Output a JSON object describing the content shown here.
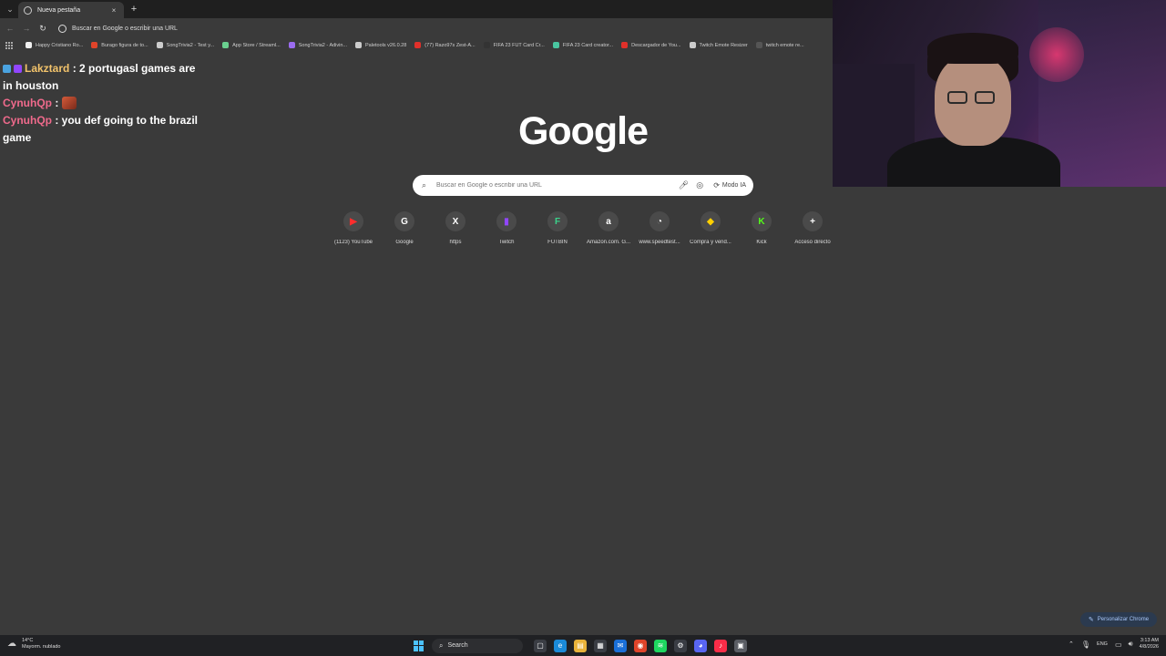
{
  "tab": {
    "title": "Nueva pestaña",
    "close": "×",
    "new": "+"
  },
  "toolbar": {
    "back": "←",
    "forward": "→",
    "reload": "↻",
    "omnibox_text": "Buscar en Google o escribir una URL"
  },
  "bookmarks": [
    {
      "label": "Happy Cristiano Ro...",
      "color": "#f0f0f0"
    },
    {
      "label": "Burago figura de to...",
      "color": "#e0442a"
    },
    {
      "label": "SongTrivia2 - Test y...",
      "color": "#cccccc"
    },
    {
      "label": "App Store / Streaml...",
      "color": "#6ad08f"
    },
    {
      "label": "SongTrivia2 - Adivin...",
      "color": "#9b6cf0"
    },
    {
      "label": "Paletools v26.0.28",
      "color": "#cccccc"
    },
    {
      "label": "(77) Razo97s Zest-A...",
      "color": "#e0302a"
    },
    {
      "label": "FIFA 23 FUT Card Cr...",
      "color": "#333333"
    },
    {
      "label": "FIFA 23 Card creator...",
      "color": "#49c5a0"
    },
    {
      "label": "Descargador de You...",
      "color": "#e0302a"
    },
    {
      "label": "Twitch Emote Resizer",
      "color": "#cccccc"
    },
    {
      "label": "twitch emote re...",
      "color": "#555555"
    }
  ],
  "chat": {
    "line1_user": "Lakztard",
    "line1_msg": ": 2 portugasl games are in houston",
    "line2_user": "CynuhQp",
    "line2_sep": ":",
    "line3_user": "CynuhQp",
    "line3_msg": ": you def going to the brazil game"
  },
  "google": {
    "logo": "Google",
    "search_placeholder": "Buscar en Google o escribir una URL",
    "ai_mode": "Modo IA"
  },
  "shortcuts": [
    {
      "label": "(1123) YouTube",
      "icon": "▶",
      "color": "#ff2d2d",
      "icon_name": "youtube-icon"
    },
    {
      "label": "Google",
      "icon": "G",
      "color": "#ffffff",
      "icon_name": "google-icon"
    },
    {
      "label": "https",
      "icon": "X",
      "color": "#ffffff",
      "icon_name": "x-icon"
    },
    {
      "label": "Twitch",
      "icon": "▮",
      "color": "#9146ff",
      "icon_name": "twitch-icon"
    },
    {
      "label": "FUTBIN",
      "icon": "F",
      "color": "#3bd38b",
      "icon_name": "futbin-icon"
    },
    {
      "label": "Amazon.com. G...",
      "icon": "a",
      "color": "#ffffff",
      "icon_name": "amazon-icon"
    },
    {
      "label": "www.speedtest...",
      "icon": "◔",
      "color": "#ffffff",
      "icon_name": "speedtest-icon"
    },
    {
      "label": "Compra y vend...",
      "icon": "◆",
      "color": "#ffd000",
      "icon_name": "store-icon"
    },
    {
      "label": "Kick",
      "icon": "K",
      "color": "#53fc18",
      "icon_name": "kick-icon"
    },
    {
      "label": "Acceso directo",
      "icon": "+",
      "color": "#ffffff",
      "icon_name": "add-shortcut-icon"
    }
  ],
  "personalize": "Personalizar Chrome",
  "taskbar": {
    "weather_temp": "14°C",
    "weather_desc": "Mayorm. nublado",
    "search": "Search",
    "lang": "ENG",
    "time": "3:13 AM",
    "date": "4/8/2026",
    "apps": [
      {
        "name": "file-icon",
        "glyph": "▢",
        "color": "#3a3d44"
      },
      {
        "name": "edge-icon",
        "glyph": "e",
        "color": "#1a8ad8"
      },
      {
        "name": "folder-icon",
        "glyph": "▤",
        "color": "#e8b23a"
      },
      {
        "name": "store-icon",
        "glyph": "▦",
        "color": "#3a3d44"
      },
      {
        "name": "mail-icon",
        "glyph": "✉",
        "color": "#1a6fd8"
      },
      {
        "name": "chrome-icon",
        "glyph": "◉",
        "color": "#e0442a"
      },
      {
        "name": "spotify-icon",
        "glyph": "≋",
        "color": "#1ed760"
      },
      {
        "name": "settings-icon",
        "glyph": "⚙",
        "color": "#3a3d44"
      },
      {
        "name": "discord-icon",
        "glyph": "◕",
        "color": "#5865f2"
      },
      {
        "name": "music-icon",
        "glyph": "♪",
        "color": "#fa2d48"
      },
      {
        "name": "app-icon",
        "glyph": "▣",
        "color": "#5a5d64"
      }
    ]
  }
}
